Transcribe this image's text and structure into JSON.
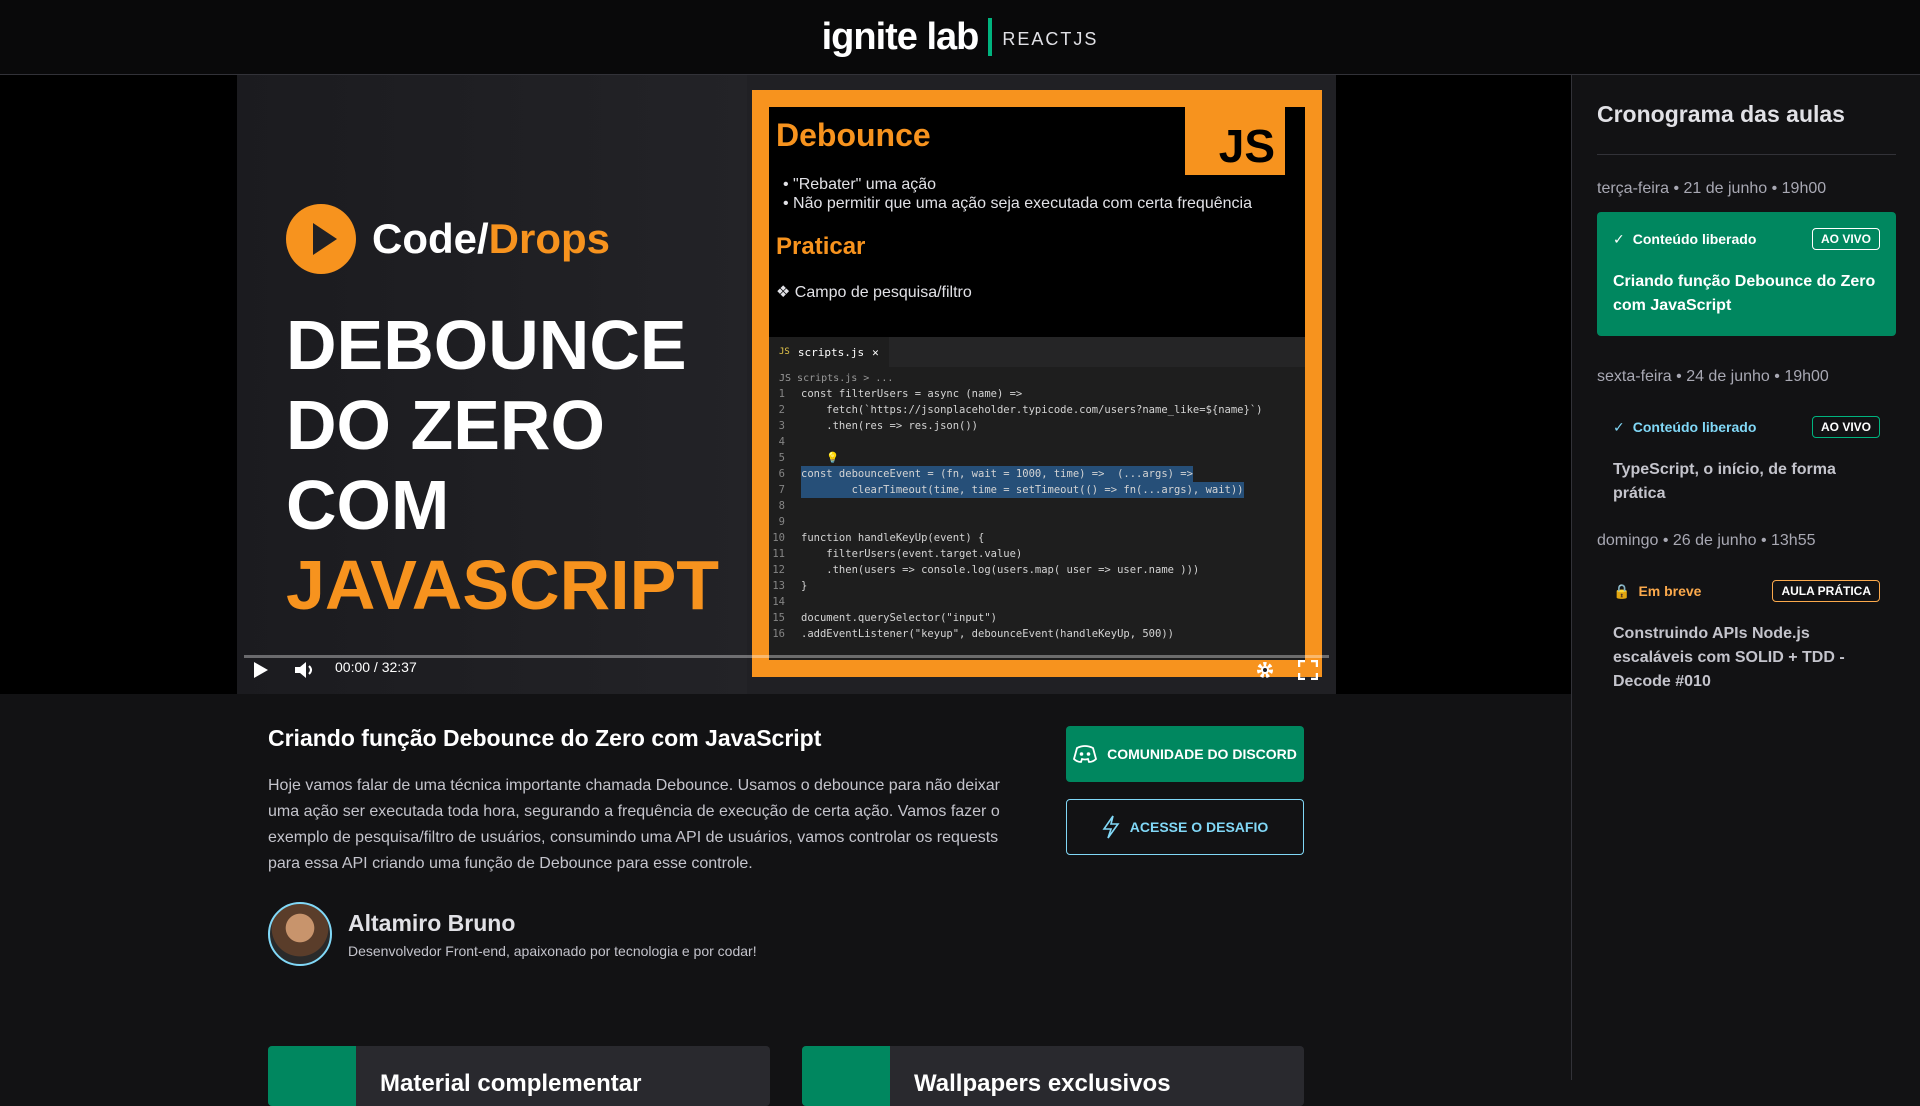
{
  "header": {
    "logo_main": "ignite lab",
    "logo_sub": "REACTJS"
  },
  "video": {
    "brand_prefix": "Code/",
    "brand_suffix": "Drops",
    "headline_1": "DEBOUNCE",
    "headline_2": "DO ZERO COM",
    "headline_3": "JAVASCRIPT",
    "slide": {
      "title": "Debounce",
      "js_badge": "JS",
      "bullets": [
        "\"Rebater\" uma ação",
        "Não permitir que uma ação seja executada com certa frequência"
      ],
      "title2": "Praticar",
      "item": "❖ Campo de pesquisa/filtro",
      "editor_tab": "scripts.js",
      "editor_tab_lang": "JS",
      "editor_crumb": "JS scripts.js > ...",
      "code_lines": [
        {
          "n": "1",
          "t": "const filterUsers = async (name) =>"
        },
        {
          "n": "2",
          "t": "    fetch(`https://jsonplaceholder.typicode.com/users?name_like=${name}`)"
        },
        {
          "n": "3",
          "t": "    .then(res => res.json())"
        },
        {
          "n": "4",
          "t": ""
        },
        {
          "n": "5",
          "t": "    💡"
        },
        {
          "n": "6",
          "t": "const debounceEvent = (fn, wait = 1000, time) =>  (...args) =>"
        },
        {
          "n": "7",
          "t": "        clearTimeout(time, time = setTimeout(() => fn(...args), wait))"
        },
        {
          "n": "8",
          "t": ""
        },
        {
          "n": "9",
          "t": ""
        },
        {
          "n": "10",
          "t": "function handleKeyUp(event) {"
        },
        {
          "n": "11",
          "t": "    filterUsers(event.target.value)"
        },
        {
          "n": "12",
          "t": "    .then(users => console.log(users.map( user => user.name )))"
        },
        {
          "n": "13",
          "t": "}"
        },
        {
          "n": "14",
          "t": ""
        },
        {
          "n": "15",
          "t": "document.querySelector(\"input\")"
        },
        {
          "n": "16",
          "t": ".addEventListener(\"keyup\", debounceEvent(handleKeyUp, 500))"
        }
      ]
    },
    "time_current": "00:00",
    "time_total": "32:37",
    "progress": 0
  },
  "sidebar": {
    "title": "Cronograma das aulas",
    "lessons": [
      {
        "date": "terça-feira • 21 de junho • 19h00",
        "status": "Conteúdo liberado",
        "tag": "AO VIVO",
        "title": "Criando função Debounce do Zero com JavaScript",
        "active": true
      },
      {
        "date": "sexta-feira • 24 de junho • 19h00",
        "status": "Conteúdo liberado",
        "tag": "AO VIVO",
        "title": "TypeScript, o início, de forma prática",
        "active": false
      },
      {
        "date": "domingo • 26 de junho • 13h55",
        "status": "Em breve",
        "tag": "AULA PRÁTICA",
        "title": "Construindo APIs Node.js escaláveis com SOLID + TDD - Decode #010",
        "active": false
      }
    ]
  },
  "lesson": {
    "title": "Criando função Debounce do Zero com JavaScript",
    "description": "Hoje vamos falar de uma técnica importante chamada Debounce. Usamos o debounce para não deixar uma ação ser executada toda hora, segurando a frequência de execução de certa ação. Vamos fazer o exemplo de pesquisa/filtro de usuários, consumindo uma API de usuários, vamos controlar os requests para essa API criando uma função de Debounce para esse controle.",
    "author_name": "Altamiro Bruno",
    "author_bio": "Desenvolvedor Front-end, apaixonado por tecnologia e por codar!",
    "discord_button": "COMUNIDADE DO DISCORD",
    "challenge_button": "ACESSE O DESAFIO"
  },
  "bottom_cards": [
    "Material complementar",
    "Wallpapers exclusivos"
  ],
  "colors": {
    "accent_green": "#00875f",
    "accent_blue": "#81d8f7",
    "accent_orange": "#fba94c",
    "brand_orange": "#f7931e"
  }
}
